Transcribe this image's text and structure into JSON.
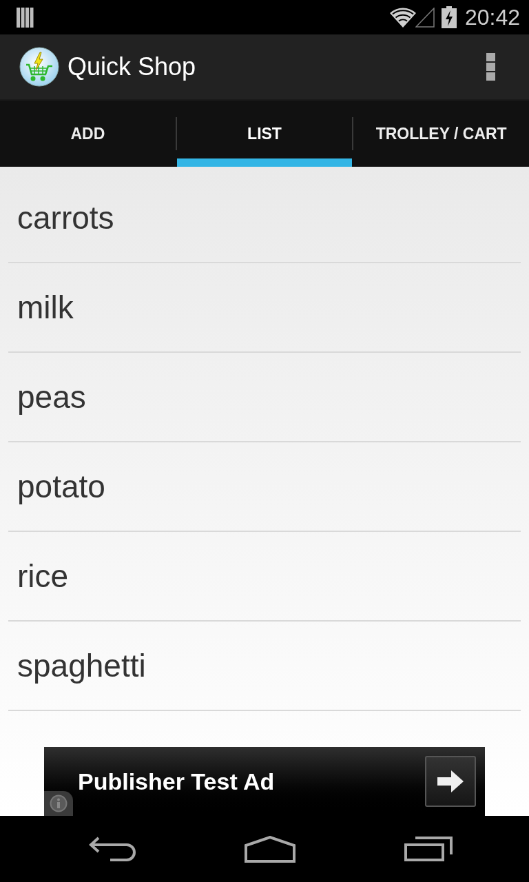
{
  "status_bar": {
    "time": "20:42"
  },
  "action_bar": {
    "title": "Quick Shop"
  },
  "tabs": [
    {
      "label": "ADD",
      "selected": false
    },
    {
      "label": "LIST",
      "selected": true
    },
    {
      "label": "TROLLEY / CART",
      "selected": false
    }
  ],
  "list": {
    "items": [
      "carrots",
      "milk",
      "peas",
      "potato",
      "rice",
      "spaghetti"
    ]
  },
  "ad": {
    "title": "Publisher Test Ad"
  }
}
